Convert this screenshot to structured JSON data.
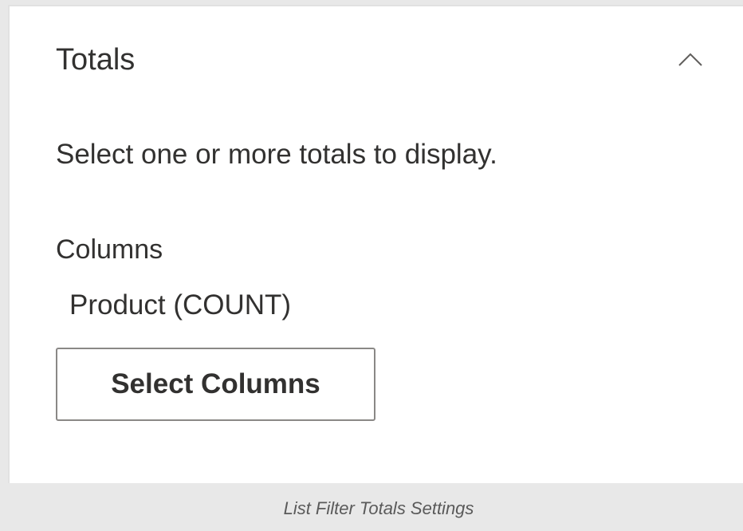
{
  "section": {
    "title": "Totals",
    "expanded": true,
    "toggle_icon": "chevron-up-icon"
  },
  "description": "Select one or more totals to display.",
  "columns": {
    "label": "Columns",
    "selected": [
      "Product (COUNT)"
    ],
    "button_label": "Select Columns"
  },
  "caption": "List Filter Totals Settings",
  "colors": {
    "text": "#323130",
    "button_border": "#8a8886",
    "caption_background": "#e8e8e8",
    "caption_text": "#5a5a5a"
  }
}
